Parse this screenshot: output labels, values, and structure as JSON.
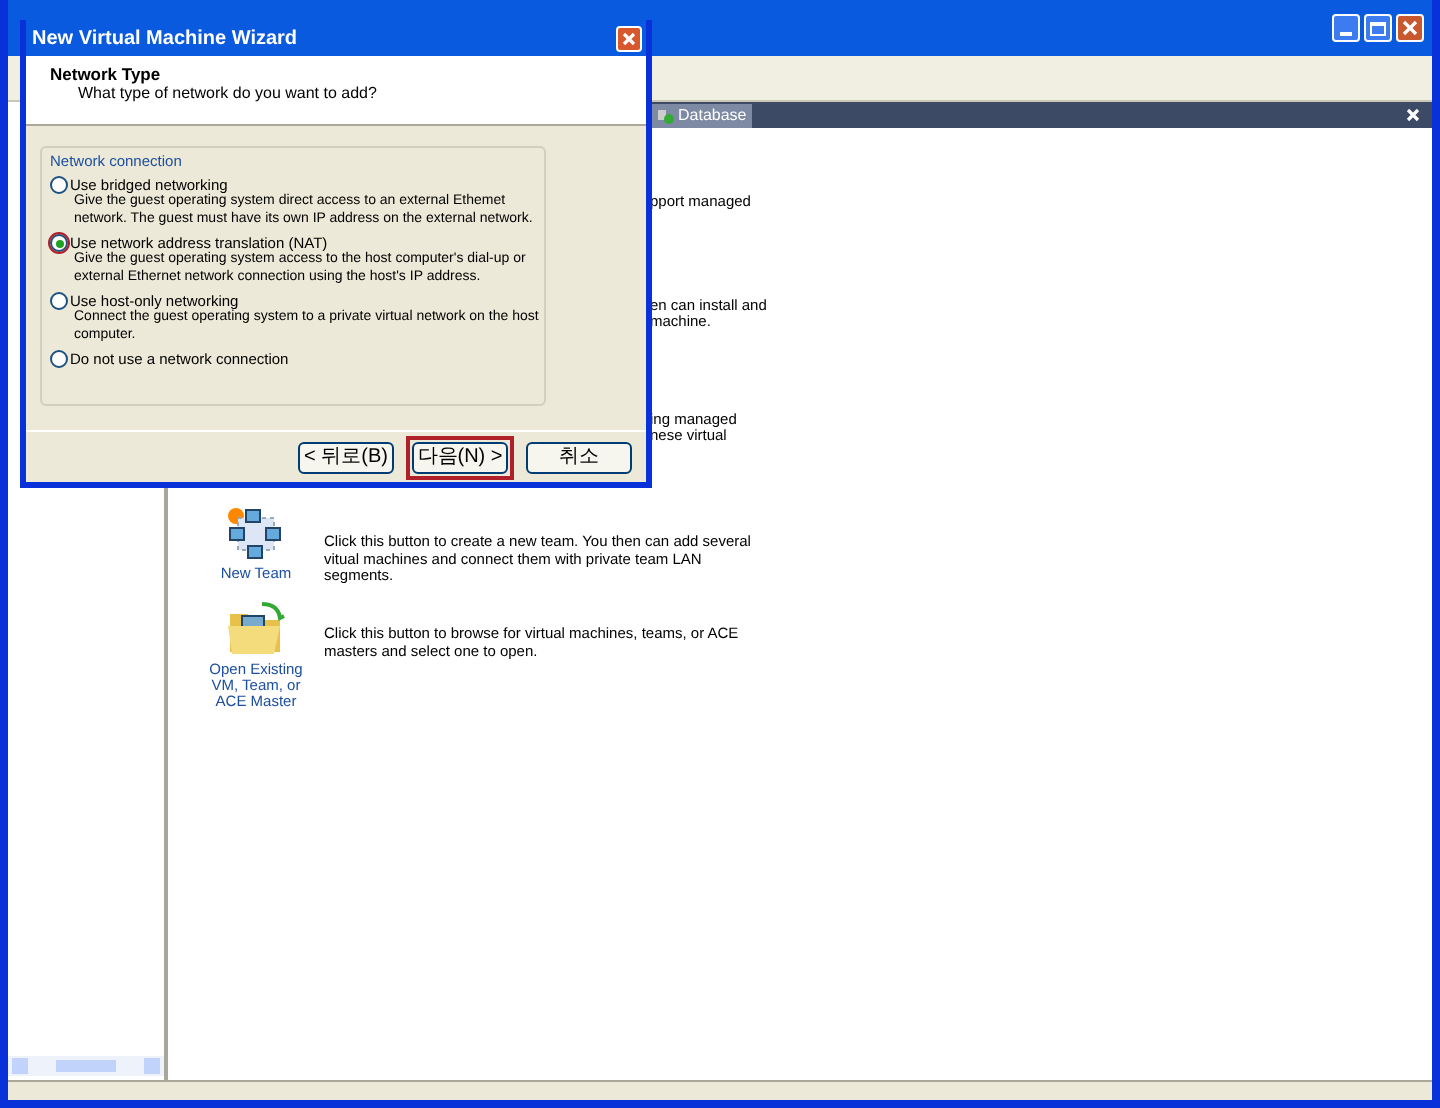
{
  "main_window": {
    "tab": {
      "label": "Database"
    },
    "partial_texts": [
      "pport managed",
      "en can install and",
      "machine.",
      "ing managed",
      "nese virtual"
    ],
    "home_items": [
      {
        "kind": "team",
        "label": "New Team",
        "description": "Click this button to create a new team. You then can add several vitual machines and connect them with private team LAN segments."
      },
      {
        "kind": "open",
        "label": "Open Existing VM, Team, or ACE Master",
        "description": "Click this button to browse for virtual machines, teams, or ACE masters and select one to open."
      }
    ]
  },
  "dialog": {
    "title": "New Virtual Machine Wizard",
    "heading": "Network Type",
    "subheading": "What type of network do you want to add?",
    "group_label": "Network connection",
    "options": [
      {
        "label": "Use bridged networking",
        "description": "Give the guest operating system direct access to an external Ethemet network. The guest must have its own IP address on the external network.",
        "selected": false,
        "highlighted": false
      },
      {
        "label": "Use network address translation (NAT)",
        "description": "Give the guest operating system access to the host computer's dial-up or external Ethernet network connection using the host's IP address.",
        "selected": true,
        "highlighted": true
      },
      {
        "label": "Use host-only networking",
        "description": "Connect the guest operating system to a private virtual network on the host computer.",
        "selected": false,
        "highlighted": false
      },
      {
        "label": "Do not use a network connection",
        "selected": false,
        "highlighted": false
      }
    ],
    "buttons": [
      {
        "label": "< 뒤로(B)",
        "highlighted": false
      },
      {
        "label": "다음(N) >",
        "highlighted": true
      },
      {
        "label": "취소",
        "highlighted": false
      }
    ]
  }
}
